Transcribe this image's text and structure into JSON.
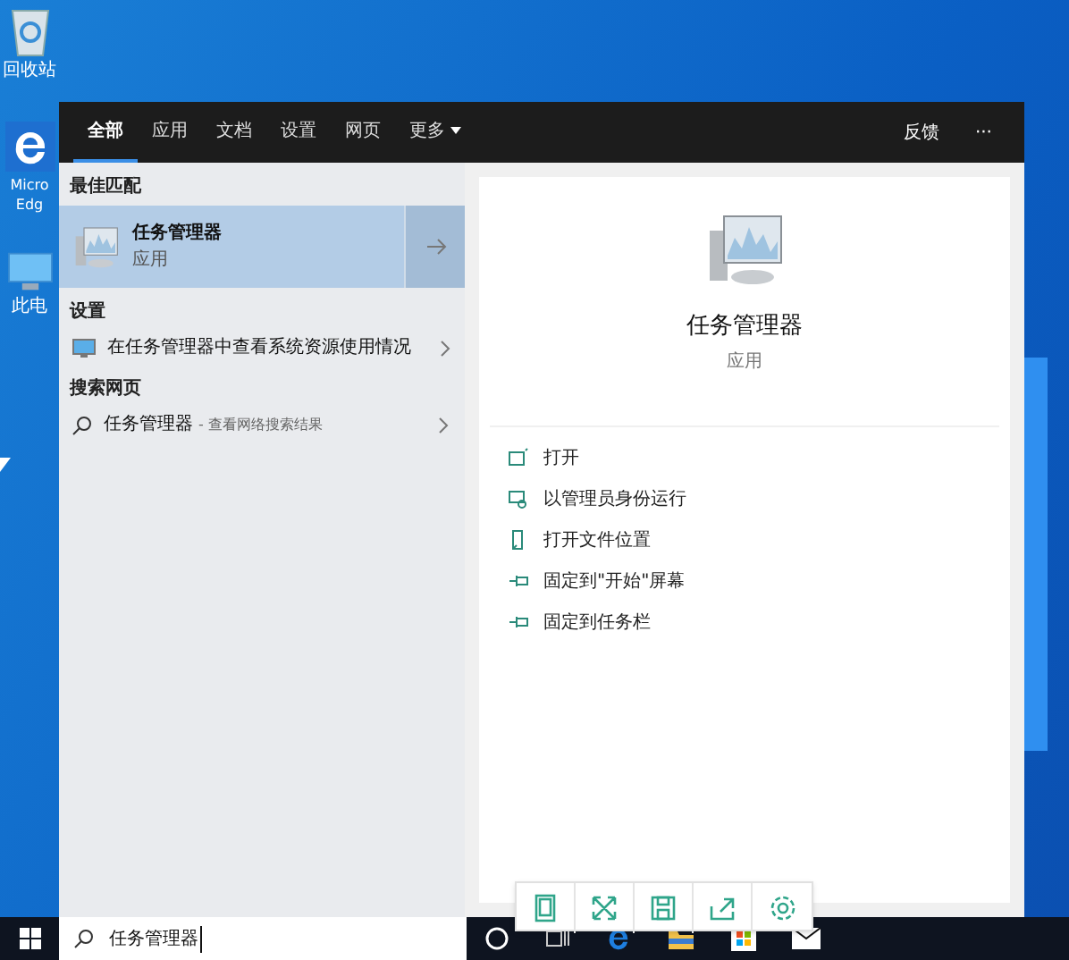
{
  "desktop_icons": [
    {
      "kind": "bin",
      "label": "回收站"
    },
    {
      "kind": "edge",
      "label": "Micro Edg"
    },
    {
      "kind": "pc",
      "label": "此电"
    }
  ],
  "search_panel": {
    "tabs": [
      {
        "label": "全部",
        "selected": true
      },
      {
        "label": "应用",
        "selected": false
      },
      {
        "label": "文档",
        "selected": false
      },
      {
        "label": "设置",
        "selected": false
      },
      {
        "label": "网页",
        "selected": false
      },
      {
        "label": "更多",
        "selected": false,
        "dropdown": true
      }
    ],
    "feedback": "反馈",
    "more": "···",
    "sections": [
      {
        "heading": "最佳匹配",
        "items": [
          {
            "kind": "app",
            "title": "任务管理器",
            "subtitle": "应用",
            "selected": true
          }
        ]
      },
      {
        "heading": "设置",
        "items": [
          {
            "kind": "setting",
            "title": "在任务管理器中查看系统资源使用情况",
            "selected": false
          }
        ]
      },
      {
        "heading": "搜索网页",
        "items": [
          {
            "kind": "web",
            "title": "任务管理器",
            "subtitle": "- 查看网络搜索结果",
            "selected": false
          }
        ]
      }
    ],
    "preview": {
      "title": "任务管理器",
      "subtitle": "应用",
      "actions": [
        {
          "kind": "open",
          "label": "打开"
        },
        {
          "kind": "admin",
          "label": "以管理员身份运行"
        },
        {
          "kind": "folder",
          "label": "打开文件位置"
        },
        {
          "kind": "pin",
          "label": "固定到\"开始\"屏幕"
        },
        {
          "kind": "pin",
          "label": "固定到任务栏"
        }
      ]
    }
  },
  "floating_toolbar": [
    {
      "kind": "tablet"
    },
    {
      "kind": "expand"
    },
    {
      "kind": "save"
    },
    {
      "kind": "share"
    },
    {
      "kind": "settings"
    }
  ],
  "taskbar": {
    "search_value": "任务管理器"
  }
}
